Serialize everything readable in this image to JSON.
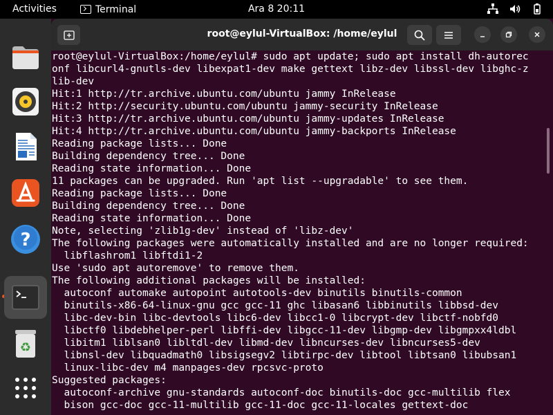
{
  "topbar": {
    "activities": "Activities",
    "app_name": "Terminal",
    "clock": "Ara 8  20:11"
  },
  "dock": {
    "items": [
      {
        "name": "files",
        "icon": "folder-icon"
      },
      {
        "name": "rhythmbox",
        "icon": "music-icon"
      },
      {
        "name": "libreoffice-writer",
        "icon": "document-icon"
      },
      {
        "name": "app-center",
        "icon": "store-icon"
      },
      {
        "name": "help",
        "icon": "help-icon"
      },
      {
        "name": "terminal",
        "icon": "terminal-icon",
        "active": true
      },
      {
        "name": "trash",
        "icon": "trash-icon"
      },
      {
        "name": "show-apps",
        "icon": "grid-icon"
      }
    ]
  },
  "window": {
    "title": "root@eylul-VirtualBox: /home/eylul",
    "background": "#300a24"
  },
  "terminal": {
    "lines": [
      "root@eylul-VirtualBox:/home/eylul# sudo apt update; sudo apt install dh-autorec",
      "onf libcurl4-gnutls-dev libexpat1-dev make gettext libz-dev libssl-dev libghc-z",
      "lib-dev",
      "Hit:1 http://tr.archive.ubuntu.com/ubuntu jammy InRelease",
      "Hit:2 http://security.ubuntu.com/ubuntu jammy-security InRelease",
      "Hit:3 http://tr.archive.ubuntu.com/ubuntu jammy-updates InRelease",
      "Hit:4 http://tr.archive.ubuntu.com/ubuntu jammy-backports InRelease",
      "Reading package lists... Done",
      "Building dependency tree... Done",
      "Reading state information... Done",
      "11 packages can be upgraded. Run 'apt list --upgradable' to see them.",
      "Reading package lists... Done",
      "Building dependency tree... Done",
      "Reading state information... Done",
      "Note, selecting 'zlib1g-dev' instead of 'libz-dev'",
      "The following packages were automatically installed and are no longer required:",
      "  libflashrom1 libftdi1-2",
      "Use 'sudo apt autoremove' to remove them.",
      "The following additional packages will be installed:",
      "  autoconf automake autopoint autotools-dev binutils binutils-common",
      "  binutils-x86-64-linux-gnu gcc gcc-11 ghc libasan6 libbinutils libbsd-dev",
      "  libc-dev-bin libc-devtools libc6-dev libcc1-0 libcrypt-dev libctf-nobfd0",
      "  libctf0 libdebhelper-perl libffi-dev libgcc-11-dev libgmp-dev libgmpxx4ldbl",
      "  libitm1 liblsan0 libltdl-dev libmd-dev libncurses-dev libncurses5-dev",
      "  libnsl-dev libquadmath0 libsigsegv2 libtirpc-dev libtool libtsan0 libubsan1",
      "  linux-libc-dev m4 manpages-dev rpcsvc-proto",
      "Suggested packages:",
      "  autoconf-archive gnu-standards autoconf-doc binutils-doc gcc-multilib flex",
      "  bison gcc-doc gcc-11-multilib gcc-11-doc gcc-11-locales gettext-doc"
    ]
  }
}
